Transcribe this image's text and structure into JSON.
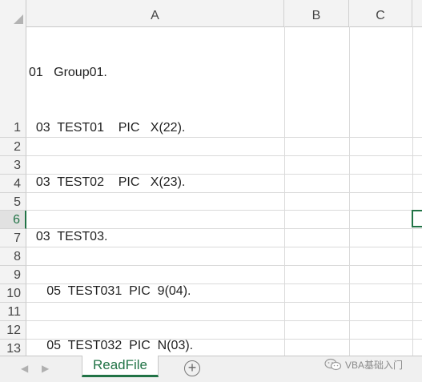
{
  "columns": [
    "A",
    "B",
    "C"
  ],
  "rows": [
    "1",
    "2",
    "3",
    "4",
    "5",
    "6",
    "7",
    "8",
    "9",
    "10",
    "11",
    "12",
    "13"
  ],
  "active_row": "6",
  "cell_a1_lines": [
    "01   Group01.",
    "  03  TEST01    PIC   X(22).",
    "  03  TEST02    PIC   X(23).",
    "  03  TEST03.",
    "     05  TEST031  PIC  9(04).",
    "     05  TEST032  PIC  N(03)."
  ],
  "sheet_tabs": [
    {
      "label": "ReadFile",
      "active": true
    }
  ],
  "add_sheet_symbol": "+",
  "nav": {
    "prev": "◀",
    "next": "▶"
  },
  "watermark_text": "VBA基础入门",
  "colors": {
    "accent": "#217346",
    "grid": "#dadada",
    "header_bg": "#f3f3f3"
  }
}
